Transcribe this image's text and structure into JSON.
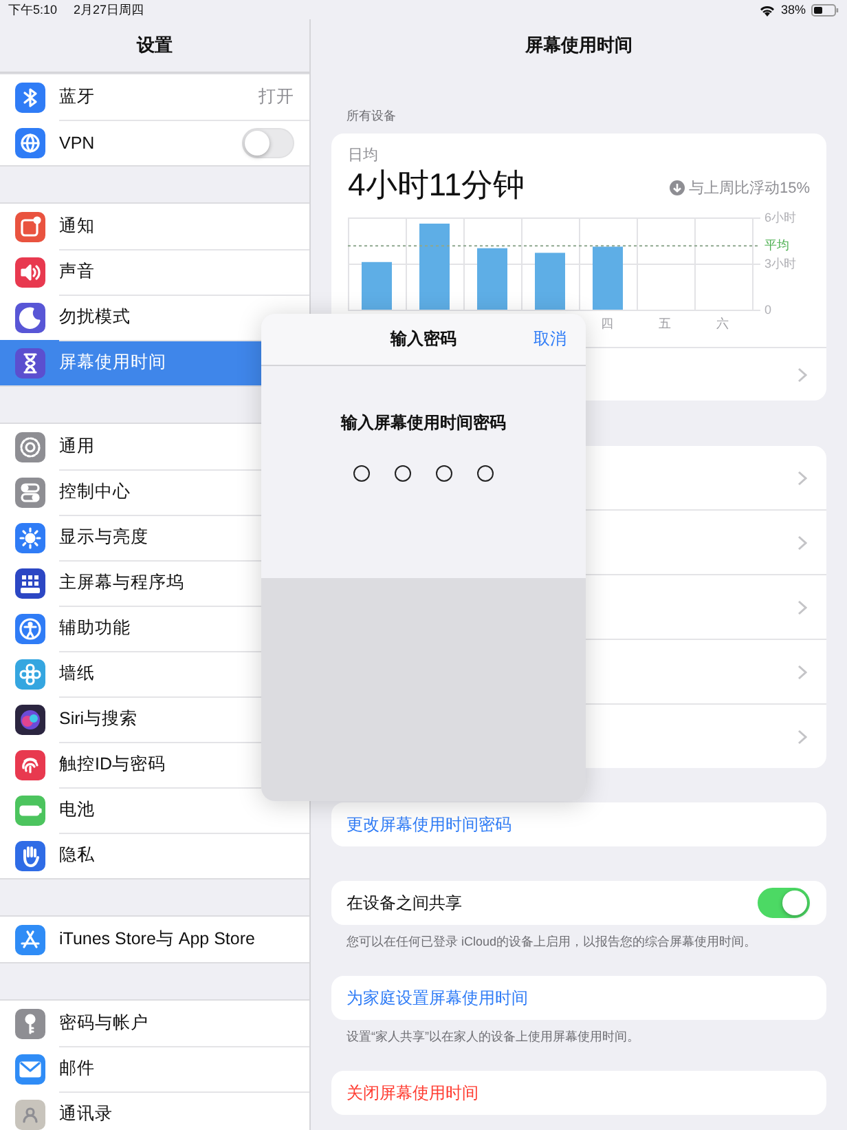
{
  "status_bar": {
    "time": "下午5:10",
    "date": "2月27日周四",
    "battery": "38%"
  },
  "sidebar": {
    "title": "设置",
    "groups": [
      {
        "items": [
          {
            "label": "蓝牙",
            "kind": "value",
            "value": "打开",
            "color": "#2f7cf6",
            "selected": false
          },
          {
            "label": "VPN",
            "kind": "toggle",
            "on": false,
            "color": "#2f7cf6",
            "selected": false
          }
        ]
      },
      {
        "items": [
          {
            "label": "通知",
            "kind": "plain",
            "color": "#e9533f",
            "selected": false
          },
          {
            "label": "声音",
            "kind": "plain",
            "color": "#e8394f",
            "selected": false
          },
          {
            "label": "勿扰模式",
            "kind": "plain",
            "color": "#5856d6",
            "selected": false
          },
          {
            "label": "屏幕使用时间",
            "kind": "plain",
            "color": "#5b4fcf",
            "selected": true
          }
        ]
      },
      {
        "items": [
          {
            "label": "通用",
            "kind": "plain",
            "color": "#8e8e93",
            "selected": false
          },
          {
            "label": "控制中心",
            "kind": "plain",
            "color": "#8e8e93",
            "selected": false
          },
          {
            "label": "显示与亮度",
            "kind": "plain",
            "color": "#2f7cf6",
            "selected": false
          },
          {
            "label": "主屏幕与程序坞",
            "kind": "plain",
            "color": "#2c47c4",
            "selected": false
          },
          {
            "label": "辅助功能",
            "kind": "plain",
            "color": "#2f7cf6",
            "selected": false
          },
          {
            "label": "墙纸",
            "kind": "plain",
            "color": "#35a6e0",
            "selected": false
          },
          {
            "label": "Siri与搜索",
            "kind": "plain",
            "color": "#2b2540",
            "selected": false
          },
          {
            "label": "触控ID与密码",
            "kind": "plain",
            "color": "#e8394f",
            "selected": false
          },
          {
            "label": "电池",
            "kind": "plain",
            "color": "#4cc45e",
            "selected": false
          },
          {
            "label": "隐私",
            "kind": "plain",
            "color": "#2f6ce6",
            "selected": false
          }
        ]
      },
      {
        "items": [
          {
            "label": "iTunes Store与 App Store",
            "kind": "plain",
            "color": "#2f8cf6",
            "selected": false
          }
        ]
      },
      {
        "items": [
          {
            "label": "密码与帐户",
            "kind": "plain",
            "color": "#8e8e93",
            "selected": false
          },
          {
            "label": "邮件",
            "kind": "plain",
            "color": "#2f8cf6",
            "selected": false
          },
          {
            "label": "通讯录",
            "kind": "plain",
            "color": "#c8c4bc",
            "selected": false
          }
        ]
      }
    ]
  },
  "detail": {
    "title": "屏幕使用时间",
    "section_label": "所有设备",
    "summary": {
      "label": "日均",
      "value": "4小时11分钟",
      "trend": "与上周比浮动15%",
      "chart_data": {
        "type": "bar",
        "categories": [
          null,
          null,
          null,
          null,
          "四",
          "五",
          "六"
        ],
        "values": [
          3.1,
          5.6,
          4.0,
          3.7,
          4.1,
          null,
          null
        ],
        "ylim": [
          0,
          6
        ],
        "yticks": [
          {
            "value": 0,
            "label": "0"
          },
          {
            "value": 3,
            "label": "3小时"
          },
          {
            "value": 6,
            "label": "6小时"
          }
        ],
        "ref_lines": [
          {
            "axis": "y",
            "value": 4.2,
            "label": "平均"
          }
        ]
      },
      "rows": [
        {
          "chevron": true
        }
      ]
    },
    "card_rows": [
      {
        "chevron": true
      },
      {
        "chevron": true
      },
      {
        "chevron": true
      },
      {
        "chevron": true
      },
      {
        "chevron": true
      }
    ],
    "actions": [
      {
        "kind": "link",
        "label": "更改屏幕使用时间密码"
      },
      {
        "kind": "toggle",
        "label": "在设备之间共享",
        "on": true,
        "footnote": "您可以在任何已登录 iCloud的设备上启用，以报告您的综合屏幕使用时间。"
      },
      {
        "kind": "link",
        "label": "为家庭设置屏幕使用时间",
        "footnote": "设置“家人共享”以在家人的设备上使用屏幕使用时间。"
      },
      {
        "kind": "destructive",
        "label": "关闭屏幕使用时间"
      }
    ]
  },
  "passcode_dialog": {
    "title": "输入密码",
    "cancel": "取消",
    "prompt": "输入屏幕使用时间密码",
    "digits": [
      {
        "filled": false
      },
      {
        "filled": false
      },
      {
        "filled": false
      },
      {
        "filled": false
      }
    ]
  }
}
